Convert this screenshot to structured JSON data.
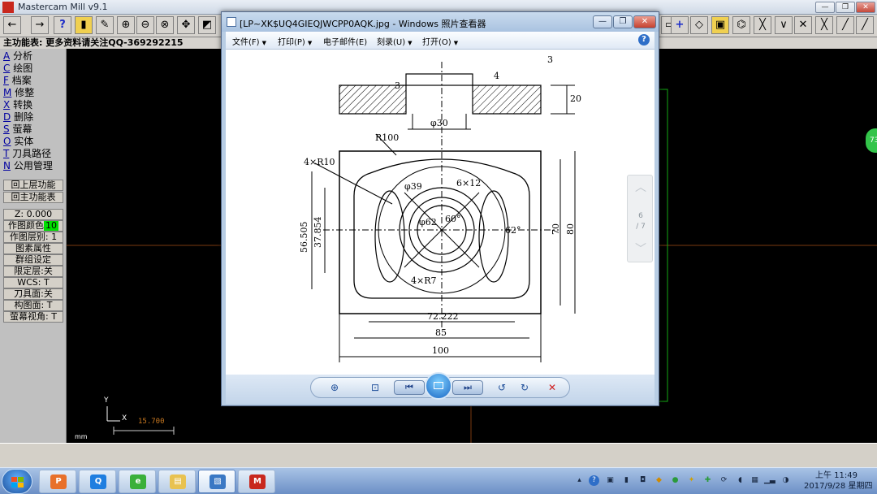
{
  "app": {
    "title": "Mastercam Mill v9.1",
    "main_menu_title": "主功能表: 更多资料请关注QQ-369292215"
  },
  "left_menu": {
    "items": [
      {
        "key": "A",
        "label": "分析"
      },
      {
        "key": "C",
        "label": "绘图"
      },
      {
        "key": "F",
        "label": "档案"
      },
      {
        "key": "M",
        "label": "修整"
      },
      {
        "key": "X",
        "label": "转换"
      },
      {
        "key": "D",
        "label": "删除"
      },
      {
        "key": "S",
        "label": "萤幕"
      },
      {
        "key": "O",
        "label": "实体"
      },
      {
        "key": "T",
        "label": "刀具路径"
      },
      {
        "key": "N",
        "label": "公用管理"
      }
    ],
    "back_label": "回上层功能",
    "main_label": "回主功能表",
    "z_label": "Z:",
    "z_value": "0.000",
    "color_label": "作图颜色",
    "color_value": "10",
    "level_label": "作图层别:",
    "level_value": "1",
    "attr_label": "图素属性",
    "group_label": "群组设定",
    "limit_label": "限定层:关",
    "wcs_label": "WCS:",
    "wcs_value": "T",
    "toolplane_label": "刀具面:关",
    "cplane_label": "构图面:",
    "cplane_value": "T",
    "view_label": "萤幕视角:",
    "view_value": "T"
  },
  "canvas": {
    "axis_y": "Y",
    "axis_x": "X",
    "scale_value": "15.700",
    "units": "mm"
  },
  "viewer": {
    "title": "[LP~XK$UQ4GIEQJWCPP0AQK.jpg - Windows 照片查看器",
    "menu": [
      {
        "label": "文件(F)"
      },
      {
        "label": "打印(P)"
      },
      {
        "label": "电子邮件(E)"
      },
      {
        "label": "刻录(U)"
      },
      {
        "label": "打开(O)"
      }
    ],
    "page_current": "6",
    "page_total": "/ 7"
  },
  "drawing": {
    "dims": {
      "d3a": "3",
      "d3b": "3",
      "d4": "4",
      "d20": "20",
      "phi30": "φ30",
      "r100": "R100",
      "r10": "4×R10",
      "phi39": "φ39",
      "n6x12": "6×12",
      "phi62": "φ62",
      "a60": "60°",
      "a62": "62°",
      "d56505": "56.505",
      "d37854": "37.854",
      "d70": "70",
      "d80": "80",
      "r7": "4×R7",
      "d72222": "72.222",
      "d85": "85",
      "d100": "100"
    }
  },
  "side_badge": "73",
  "tray": {
    "time": "上午 11:49",
    "date": "2017/9/28 星期四"
  }
}
